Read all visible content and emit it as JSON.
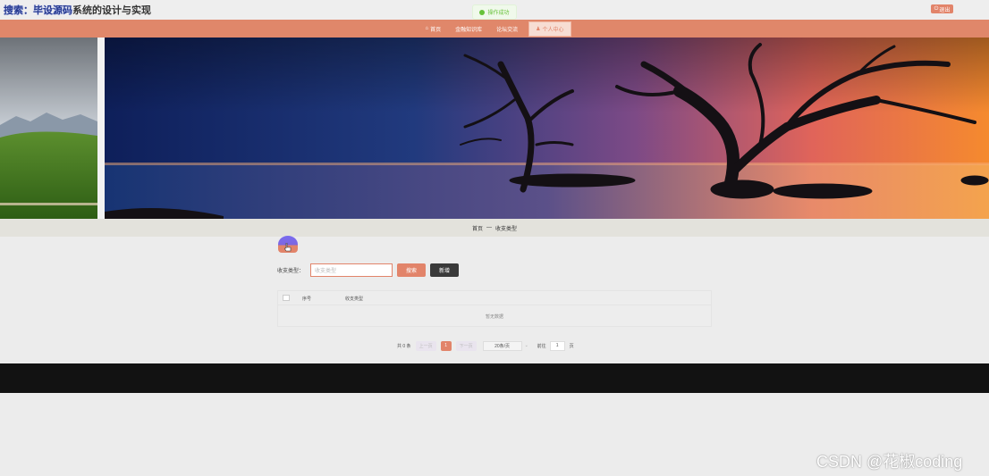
{
  "header": {
    "title_highlight": "搜索：毕设源码",
    "title_overlay": "系统的设计与实现",
    "logout_label": "退出"
  },
  "toast": {
    "message": "操作成功",
    "type": "success"
  },
  "nav": {
    "items": [
      {
        "label": "首页",
        "icon": "home-icon"
      },
      {
        "label": "金融知识库",
        "icon": ""
      },
      {
        "label": "论坛交流",
        "icon": ""
      },
      {
        "label": "个人中心",
        "icon": "user-icon",
        "active": true
      }
    ]
  },
  "breadcrumb": {
    "home": "首页",
    "separator": "—",
    "current": "收支类型"
  },
  "search": {
    "label": "收支类型：",
    "placeholder": "收支类型",
    "search_button": "搜索",
    "add_button": "新增"
  },
  "table": {
    "columns": [
      "序号",
      "收支类型"
    ],
    "empty_text": "暂无数据"
  },
  "pagination": {
    "total": "共 0 条",
    "prev": "上一页",
    "current_page": "1",
    "next": "下一页",
    "page_size": "20条/页",
    "goto_label": "前往",
    "goto_value": "1",
    "page_unit": "页"
  },
  "watermark": "CSDN @花椒coding",
  "colors": {
    "accent": "#e2846a",
    "footer": "#121212",
    "success": "#67c23a"
  }
}
